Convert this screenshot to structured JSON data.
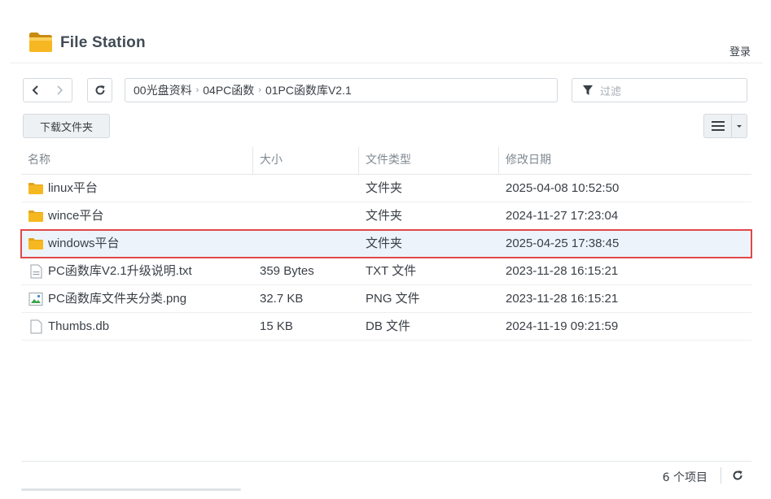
{
  "header": {
    "title": "File Station",
    "login": "登录"
  },
  "toolbar": {
    "breadcrumb": [
      "00光盘资料",
      "04PC函数",
      "01PC函数库V2.1"
    ],
    "filter_placeholder": "过滤",
    "download_label": "下载文件夹"
  },
  "table": {
    "columns": {
      "name": "名称",
      "size": "大小",
      "type": "文件类型",
      "date": "修改日期"
    },
    "rows": [
      {
        "name": "linux平台",
        "size": "",
        "type": "文件夹",
        "date": "2025-04-08 10:52:50",
        "icon": "folder-icon"
      },
      {
        "name": "wince平台",
        "size": "",
        "type": "文件夹",
        "date": "2024-11-27 17:23:04",
        "icon": "folder-icon"
      },
      {
        "name": "windows平台",
        "size": "",
        "type": "文件夹",
        "date": "2025-04-25 17:38:45",
        "icon": "folder-icon",
        "selected": true
      },
      {
        "name": "PC函数库V2.1升级说明.txt",
        "size": "359 Bytes",
        "type": "TXT 文件",
        "date": "2023-11-28 16:15:21",
        "icon": "text-file-icon"
      },
      {
        "name": "PC函数库文件夹分类.png",
        "size": "32.7 KB",
        "type": "PNG 文件",
        "date": "2023-11-28 16:15:21",
        "icon": "image-file-icon"
      },
      {
        "name": "Thumbs.db",
        "size": "15 KB",
        "type": "DB 文件",
        "date": "2024-11-19 09:21:59",
        "icon": "file-icon"
      }
    ]
  },
  "footer": {
    "count": "6 个项目"
  },
  "colors": {
    "accent_selection": "#e04848",
    "selected_row": "#edf3fb",
    "folder": "#f6b820"
  }
}
